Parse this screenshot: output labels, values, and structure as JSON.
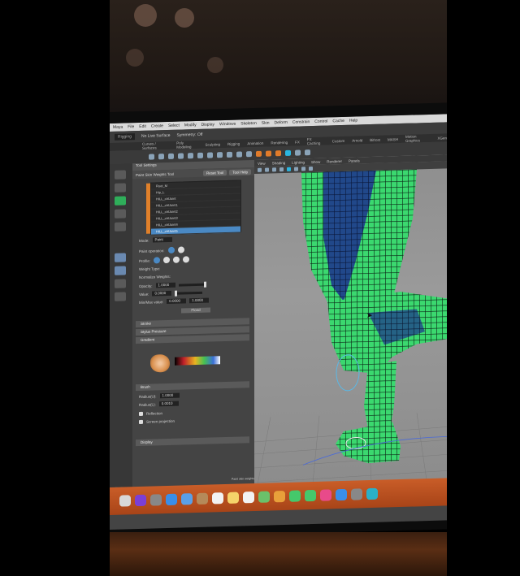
{
  "mac_menubar": {
    "items": [
      "Maya",
      "File",
      "Edit",
      "Create",
      "Select",
      "Modify",
      "Display",
      "Windows",
      "Skeleton",
      "Skin",
      "Deform",
      "Constrain",
      "Control",
      "Cache",
      "Help"
    ]
  },
  "maya_menu": {
    "workspace_field": "Rigging",
    "live_surface": "No Live Surface",
    "symmetry": "Symmetry: Off"
  },
  "shelf_tabs": [
    "Curves / Surfaces",
    "Poly Modeling",
    "Sculpting",
    "Rigging",
    "Animation",
    "Rendering",
    "FX",
    "FX Caching",
    "Custom",
    "Arnold",
    "Bifrost",
    "MASH",
    "Motion Graphics",
    "XGen"
  ],
  "tool_settings": {
    "header": "Tool Settings",
    "tool_name": "Paint Skin Weights Tool",
    "reset_button": "Reset Tool",
    "help_button": "Tool Help",
    "influences": [
      "Root_M",
      "Hip_L",
      "HILL_ctrlJoint",
      "HILL_ctrlJoint1",
      "HILL_ctrlJoint2",
      "HILL_ctrlJoint3",
      "HILL_ctrlJoint4",
      "HILL_ctrlJoint5"
    ],
    "selected_influence_index": 7,
    "mode_label": "Mode:",
    "mode_value": "Paint",
    "paint_operation_label": "Paint operation:",
    "profile_label": "Profile:",
    "weight_type_label": "Weight Type:",
    "normalize_label": "Normalize Weights:",
    "opacity_label": "Opacity:",
    "opacity_value": "1.0000",
    "value_label": "Value:",
    "value_value": "0.0000",
    "min_max_label": "Min/Max value:",
    "min_value": "0.0000",
    "max_value": "1.0000",
    "flood_button": "Flood",
    "stroke_section": "Stroke",
    "stylus_section": "Stylus Pressure",
    "gradient_section": "Gradient",
    "display_section": "Display",
    "brush_label": "Brush",
    "radius_u_label": "Radius(U):",
    "radius_u_value": "1.0000",
    "radius_l_label": "Radius(L):",
    "radius_l_value": "0.0010",
    "reflection_label": "Reflection",
    "screen_projection_label": "Screen projection",
    "display_icon": "colour-ramp"
  },
  "viewport": {
    "menu": [
      "View",
      "Shading",
      "Lighting",
      "Show",
      "Renderer",
      "Panels"
    ],
    "model": "green wireframe leg mesh",
    "status_line": "Paint skin weights"
  },
  "dock": {
    "apps": [
      "finder-icon",
      "siri-icon",
      "launchpad-icon",
      "safari-icon",
      "mail-icon",
      "contacts-icon",
      "calendar-icon",
      "notes-icon",
      "reminders-icon",
      "maps-icon",
      "photos-icon",
      "messages-icon",
      "facetime-icon",
      "itunes-icon",
      "app-store-icon",
      "system-preferences-icon",
      "maya-icon"
    ]
  },
  "colors": {
    "mesh_green": "#33e070",
    "mesh_dark": "#1a3a8a",
    "dock_orange": "#c95d28",
    "selection_blue": "#4a89c4"
  }
}
